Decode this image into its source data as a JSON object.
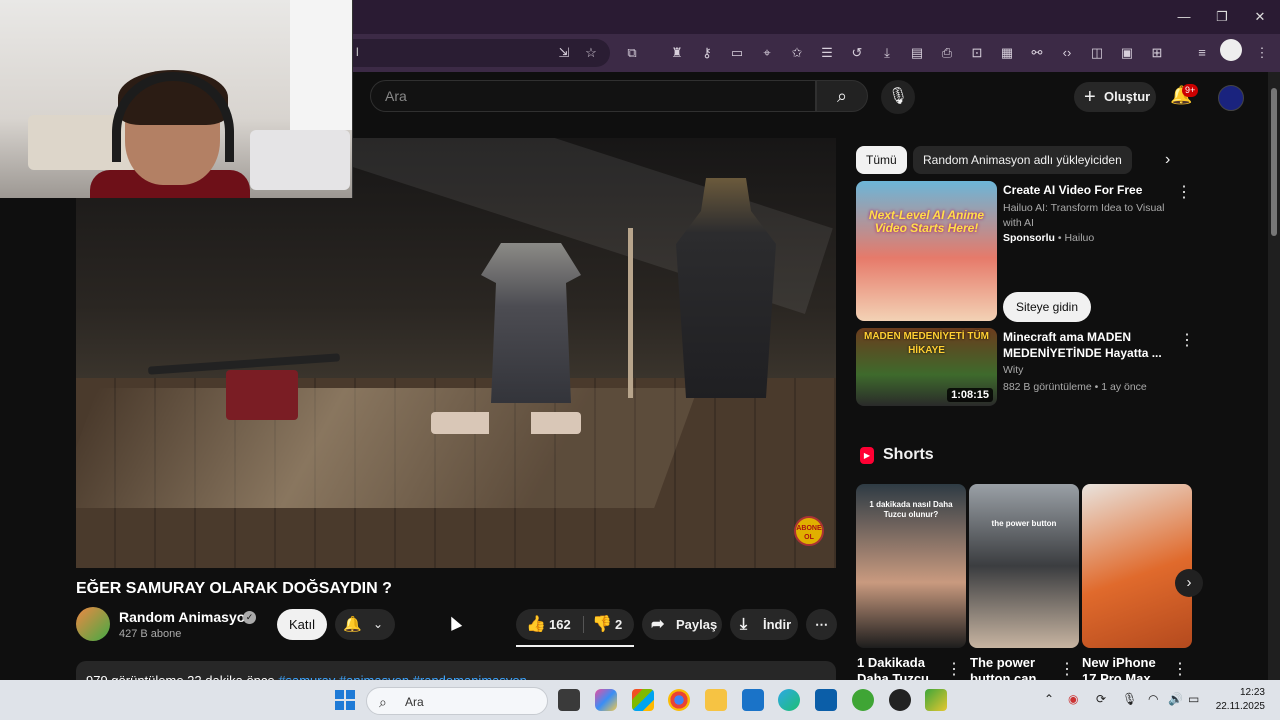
{
  "browser": {
    "window_controls": {
      "minimize": "—",
      "maximize": "❐",
      "close": "✕"
    },
    "url_fragment": "l"
  },
  "youtube_header": {
    "search_placeholder": "Ara",
    "create_label": "Oluştur",
    "notification_badge": "9+"
  },
  "video": {
    "title": "EĞER SAMURAY OLARAK DOĞSAYDIN ?",
    "overlay_badge": "ABONE OL",
    "channel": {
      "name": "Random Animasyon",
      "subscribers": "427 B abone",
      "join_label": "Katıl"
    },
    "actions": {
      "like_count": "162",
      "dislike_count": "2",
      "share_label": "Paylaş",
      "download_label": "İndir"
    },
    "description": {
      "stats": "979 görüntüleme  22 dakika önce",
      "tags": "#samuray #animasyon #randomanimasyon"
    }
  },
  "sidebar": {
    "chips": [
      {
        "label": "Tümü",
        "active": true
      },
      {
        "label": "Random Animasyon adlı yükleyiciden",
        "active": false
      }
    ],
    "ad": {
      "title": "Create AI Video For Free",
      "description": "Hailuo AI: Transform Idea to Visual with AI",
      "sponsored_label": "Sponsorlu",
      "advertiser": "Hailuo",
      "cta_label": "Siteye gidin",
      "thumb_text": "Next-Level AI Anime Video Starts Here!"
    },
    "recommended": [
      {
        "title": "Minecraft ama MADEN MEDENİYETİNDE Hayatta ...",
        "channel": "Wity",
        "meta": "882 B görüntüleme • 1 ay önce",
        "duration": "1:08:15",
        "thumb_text": "MADEN MEDENİYETİ TÜM HİKAYE"
      }
    ],
    "shorts": {
      "heading": "Shorts",
      "items": [
        {
          "title": "1 Dakikada Daha Tuzcu",
          "thumb_text": "1 dakikada nasıl Daha Tuzcu olunur?"
        },
        {
          "title": "The power button can",
          "thumb_text": "the power button"
        },
        {
          "title": "New iPhone 17 Pro Max",
          "thumb_text": ""
        }
      ]
    }
  },
  "taskbar": {
    "search_placeholder": "Ara",
    "time": "12:23",
    "date": "22.11.2025"
  }
}
